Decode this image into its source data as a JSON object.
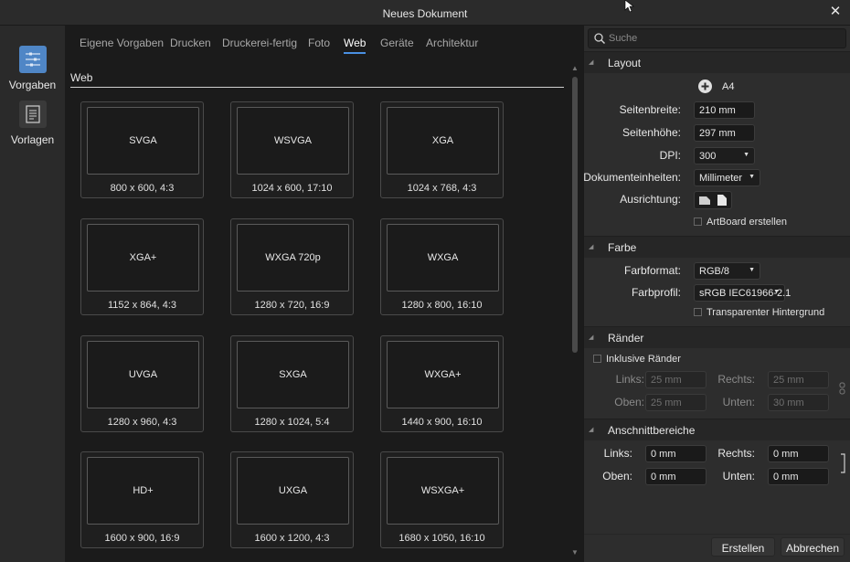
{
  "window": {
    "title": "Neues Dokument"
  },
  "sidebar": {
    "items": [
      {
        "label": "Vorgaben",
        "icon": "presets-icon"
      },
      {
        "label": "Vorlagen",
        "icon": "templates-icon"
      }
    ]
  },
  "tabs": [
    {
      "label": "Eigene Vorgaben"
    },
    {
      "label": "Drucken"
    },
    {
      "label": "Druckerei-fertig"
    },
    {
      "label": "Foto"
    },
    {
      "label": "Web",
      "active": true
    },
    {
      "label": "Geräte"
    },
    {
      "label": "Architektur"
    }
  ],
  "section_title": "Web",
  "presets": [
    {
      "name": "SVGA",
      "caption": "800 x 600, 4:3"
    },
    {
      "name": "WSVGA",
      "caption": "1024 x 600, 17:10"
    },
    {
      "name": "XGA",
      "caption": "1024 x 768, 4:3"
    },
    {
      "name": "XGA+",
      "caption": "1152 x 864, 4:3"
    },
    {
      "name": "WXGA 720p",
      "caption": "1280 x 720, 16:9"
    },
    {
      "name": "WXGA",
      "caption": "1280 x 800, 16:10"
    },
    {
      "name": "UVGA",
      "caption": "1280 x 960, 4:3"
    },
    {
      "name": "SXGA",
      "caption": "1280 x 1024, 5:4"
    },
    {
      "name": "WXGA+",
      "caption": "1440 x 900, 16:10"
    },
    {
      "name": "HD+",
      "caption": "1600 x 900, 16:9"
    },
    {
      "name": "UXGA",
      "caption": "1600 x 1200, 4:3"
    },
    {
      "name": "WSXGA+",
      "caption": "1680 x 1050, 16:10"
    }
  ],
  "search": {
    "placeholder": "Suche"
  },
  "layout": {
    "header": "Layout",
    "paper": "A4",
    "width_label": "Seitenbreite:",
    "width_value": "210 mm",
    "height_label": "Seitenhöhe:",
    "height_value": "297 mm",
    "dpi_label": "DPI:",
    "dpi_value": "300",
    "units_label": "Dokumenteinheiten:",
    "units_value": "Millimeter",
    "orientation_label": "Ausrichtung:",
    "artboard_label": "ArtBoard erstellen"
  },
  "color": {
    "header": "Farbe",
    "format_label": "Farbformat:",
    "format_value": "RGB/8",
    "profile_label": "Farbprofil:",
    "profile_value": "sRGB IEC61966-2.1",
    "transparent_label": "Transparenter Hintergrund"
  },
  "margins": {
    "header": "Ränder",
    "include_label": "Inklusive Ränder",
    "left_label": "Links:",
    "left_value": "25 mm",
    "right_label": "Rechts:",
    "right_value": "25 mm",
    "top_label": "Oben:",
    "top_value": "25 mm",
    "bottom_label": "Unten:",
    "bottom_value": "30 mm"
  },
  "bleed": {
    "header": "Anschnittbereiche",
    "left_label": "Links:",
    "left_value": "0 mm",
    "right_label": "Rechts:",
    "right_value": "0 mm",
    "top_label": "Oben:",
    "top_value": "0 mm",
    "bottom_label": "Unten:",
    "bottom_value": "0 mm"
  },
  "buttons": {
    "create": "Erstellen",
    "cancel": "Abbrechen"
  },
  "colors": {
    "accent": "#4a90e2",
    "background": "#1b1b1b",
    "panel": "#2d2d2d"
  }
}
